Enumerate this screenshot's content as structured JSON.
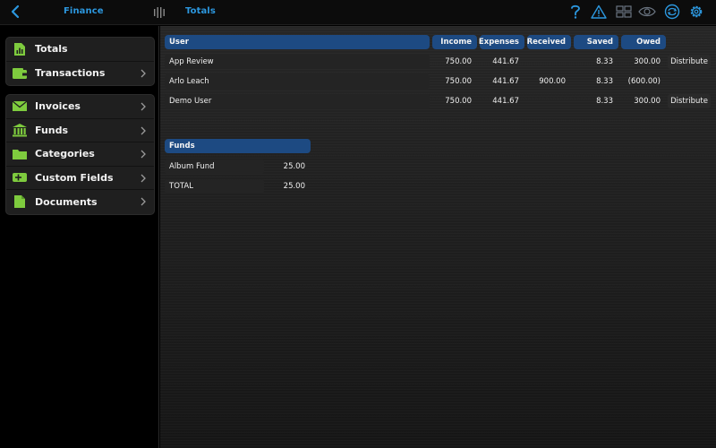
{
  "topbar": {
    "left_title": "Finance",
    "right_title": "Totals",
    "icons": [
      "help-icon",
      "warning-icon",
      "tiles-icon",
      "eye-icon",
      "sync-icon",
      "gear-icon"
    ],
    "accent": "#2c97de"
  },
  "sidebar": {
    "group1": [
      {
        "label": "Totals",
        "icon": "totals-icon",
        "chevron": false
      },
      {
        "label": "Transactions",
        "icon": "transactions-icon",
        "chevron": true
      }
    ],
    "group2": [
      {
        "label": "Invoices",
        "icon": "invoices-icon",
        "chevron": true
      },
      {
        "label": "Funds",
        "icon": "funds-icon",
        "chevron": true
      },
      {
        "label": "Categories",
        "icon": "categories-icon",
        "chevron": true
      },
      {
        "label": "Custom Fields",
        "icon": "custom-fields-icon",
        "chevron": true
      },
      {
        "label": "Documents",
        "icon": "documents-icon",
        "chevron": true
      }
    ],
    "icon_color": "#7ecb3e"
  },
  "users_table": {
    "headers": {
      "user": "User",
      "income": "Income",
      "expenses": "Expenses",
      "received": "Received",
      "saved": "Saved",
      "owed": "Owed"
    },
    "rows": [
      {
        "user": "App Review",
        "income": "750.00",
        "expenses": "441.67",
        "received": "",
        "saved": "8.33",
        "owed": "300.00",
        "action": "Distribute"
      },
      {
        "user": "Arlo Leach",
        "income": "750.00",
        "expenses": "441.67",
        "received": "900.00",
        "saved": "8.33",
        "owed": "(600.00)",
        "action": ""
      },
      {
        "user": "Demo User",
        "income": "750.00",
        "expenses": "441.67",
        "received": "",
        "saved": "8.33",
        "owed": "300.00",
        "action": "Distribute"
      }
    ],
    "header_color": "#1d4a82"
  },
  "funds_table": {
    "header": "Funds",
    "rows": [
      {
        "name": "Album Fund",
        "value": "25.00"
      },
      {
        "name": "TOTAL",
        "value": "25.00"
      }
    ]
  }
}
